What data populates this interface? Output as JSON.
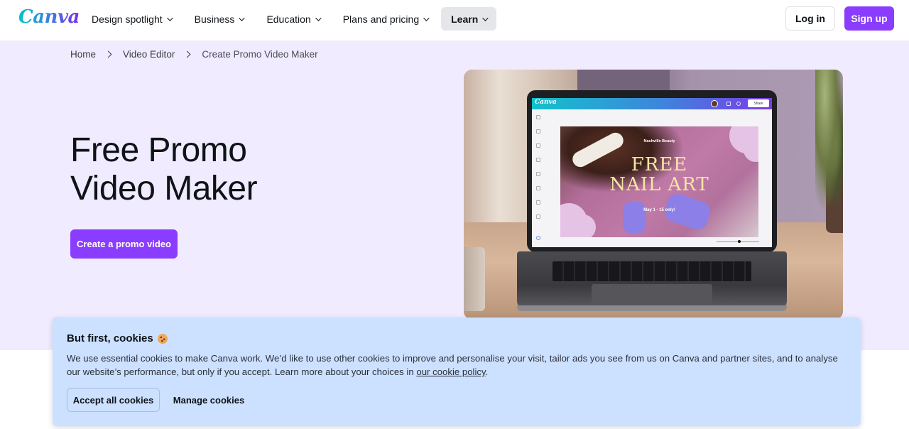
{
  "header": {
    "logo": "Canva",
    "nav": [
      {
        "label": "Design spotlight",
        "has_dropdown": true,
        "active": false
      },
      {
        "label": "Business",
        "has_dropdown": true,
        "active": false
      },
      {
        "label": "Education",
        "has_dropdown": true,
        "active": false
      },
      {
        "label": "Plans and pricing",
        "has_dropdown": true,
        "active": false
      },
      {
        "label": "Learn",
        "has_dropdown": true,
        "active": true
      }
    ],
    "login_label": "Log in",
    "signup_label": "Sign up"
  },
  "breadcrumb": {
    "items": [
      "Home",
      "Video Editor",
      "Create Promo Video Maker"
    ]
  },
  "hero": {
    "title_line1": "Free Promo",
    "title_line2": "Video Maker",
    "cta_label": "Create a promo video",
    "image": {
      "description": "Laptop on desk showing Canva editor with a nail salon promo design",
      "editor_logo": "Canva",
      "editor_share_label": "Share",
      "design_brand": "Nashville Beauty",
      "design_headline_line1": "FREE",
      "design_headline_line2": "NAIL ART",
      "design_date": "May 1 - 15 only!"
    }
  },
  "cookie_banner": {
    "title": "But first, cookies",
    "title_icon": "cookie-emoji",
    "text": "We use essential cookies to make Canva work. We’d like to use other cookies to improve and personalise your visit, tailor ads you see from us on Canva and partner sites, and to analyse our website’s performance, but only if you accept. Learn more about your choices in ",
    "link_text": "our cookie policy",
    "text_end": ".",
    "accept_label": "Accept all cookies",
    "manage_label": "Manage cookies"
  },
  "colors": {
    "brand_purple": "#8b3dff",
    "hero_bg": "#f0ebfe",
    "cookie_bg": "#cce0ff",
    "active_nav_bg": "#e4e6ea"
  }
}
